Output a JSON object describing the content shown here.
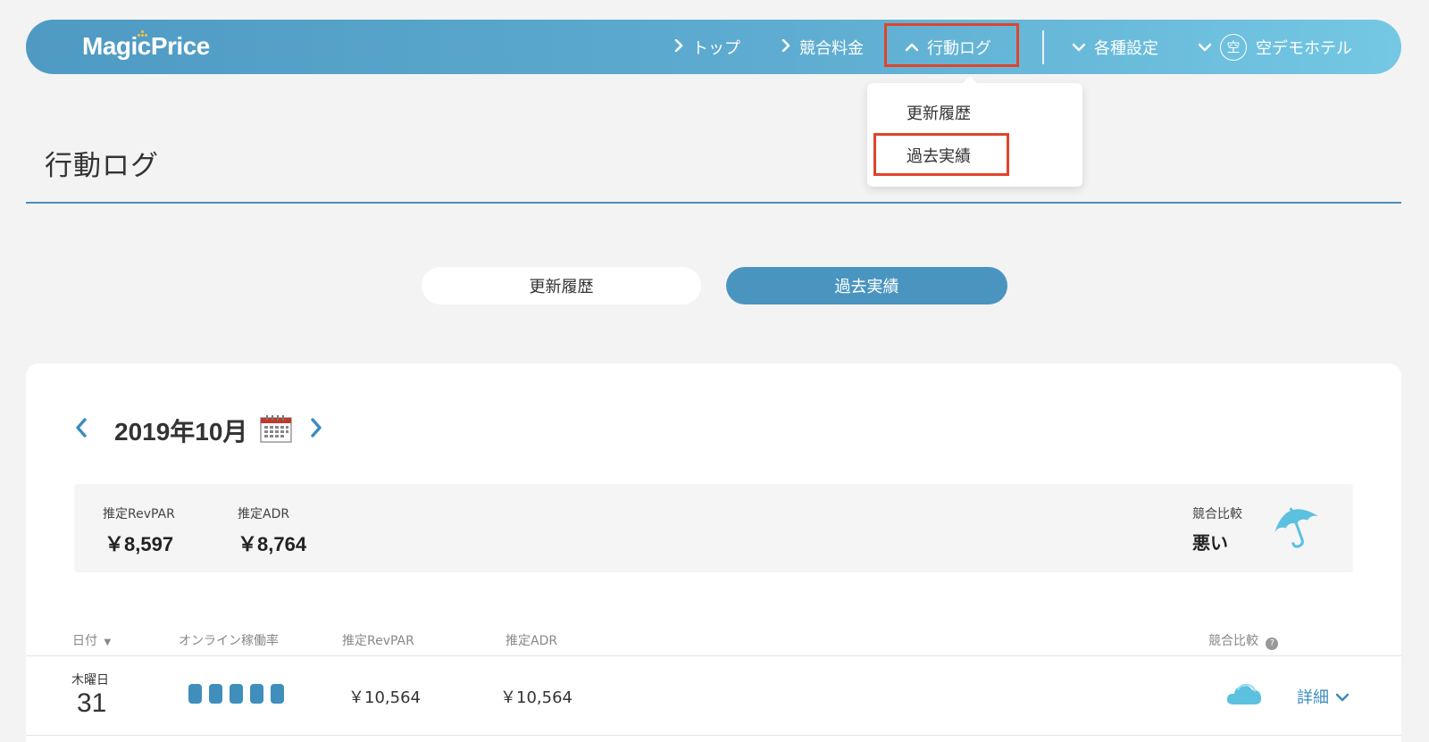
{
  "header": {
    "logo": "MagicPrice",
    "nav": [
      {
        "label": "トップ"
      },
      {
        "label": "競合料金"
      },
      {
        "label": "行動ログ"
      },
      {
        "label": "各種設定"
      }
    ],
    "avatar_char": "空",
    "hotel_name": "空デモホテル"
  },
  "dropdown": {
    "items": [
      {
        "label": "更新履歴"
      },
      {
        "label": "過去実績"
      }
    ]
  },
  "page": {
    "title": "行動ログ"
  },
  "tabs": [
    {
      "label": "更新履歴",
      "active": false
    },
    {
      "label": "過去実績",
      "active": true
    }
  ],
  "month_nav": {
    "label": "2019年10月"
  },
  "summary": {
    "revpar_label": "推定RevPAR",
    "revpar_value": "￥8,597",
    "adr_label": "推定ADR",
    "adr_value": "￥8,764",
    "compare_label": "競合比較",
    "compare_value": "悪い",
    "weather_icon": "umbrella-icon"
  },
  "table": {
    "headers": {
      "date": "日付",
      "online_rate": "オンライン稼働率",
      "revpar": "推定RevPAR",
      "adr": "推定ADR",
      "compare": "競合比較"
    },
    "rows": [
      {
        "weekday": "木曜日",
        "day": "31",
        "occupancy_bars": 5,
        "revpar": "￥10,564",
        "adr": "￥10,564",
        "weather_icon": "cloud-icon",
        "detail_label": "詳細"
      }
    ]
  },
  "colors": {
    "accent": "#4a94c0",
    "highlight": "#e0442b",
    "header_start": "#4f9ac3",
    "header_end": "#74c8e3"
  }
}
